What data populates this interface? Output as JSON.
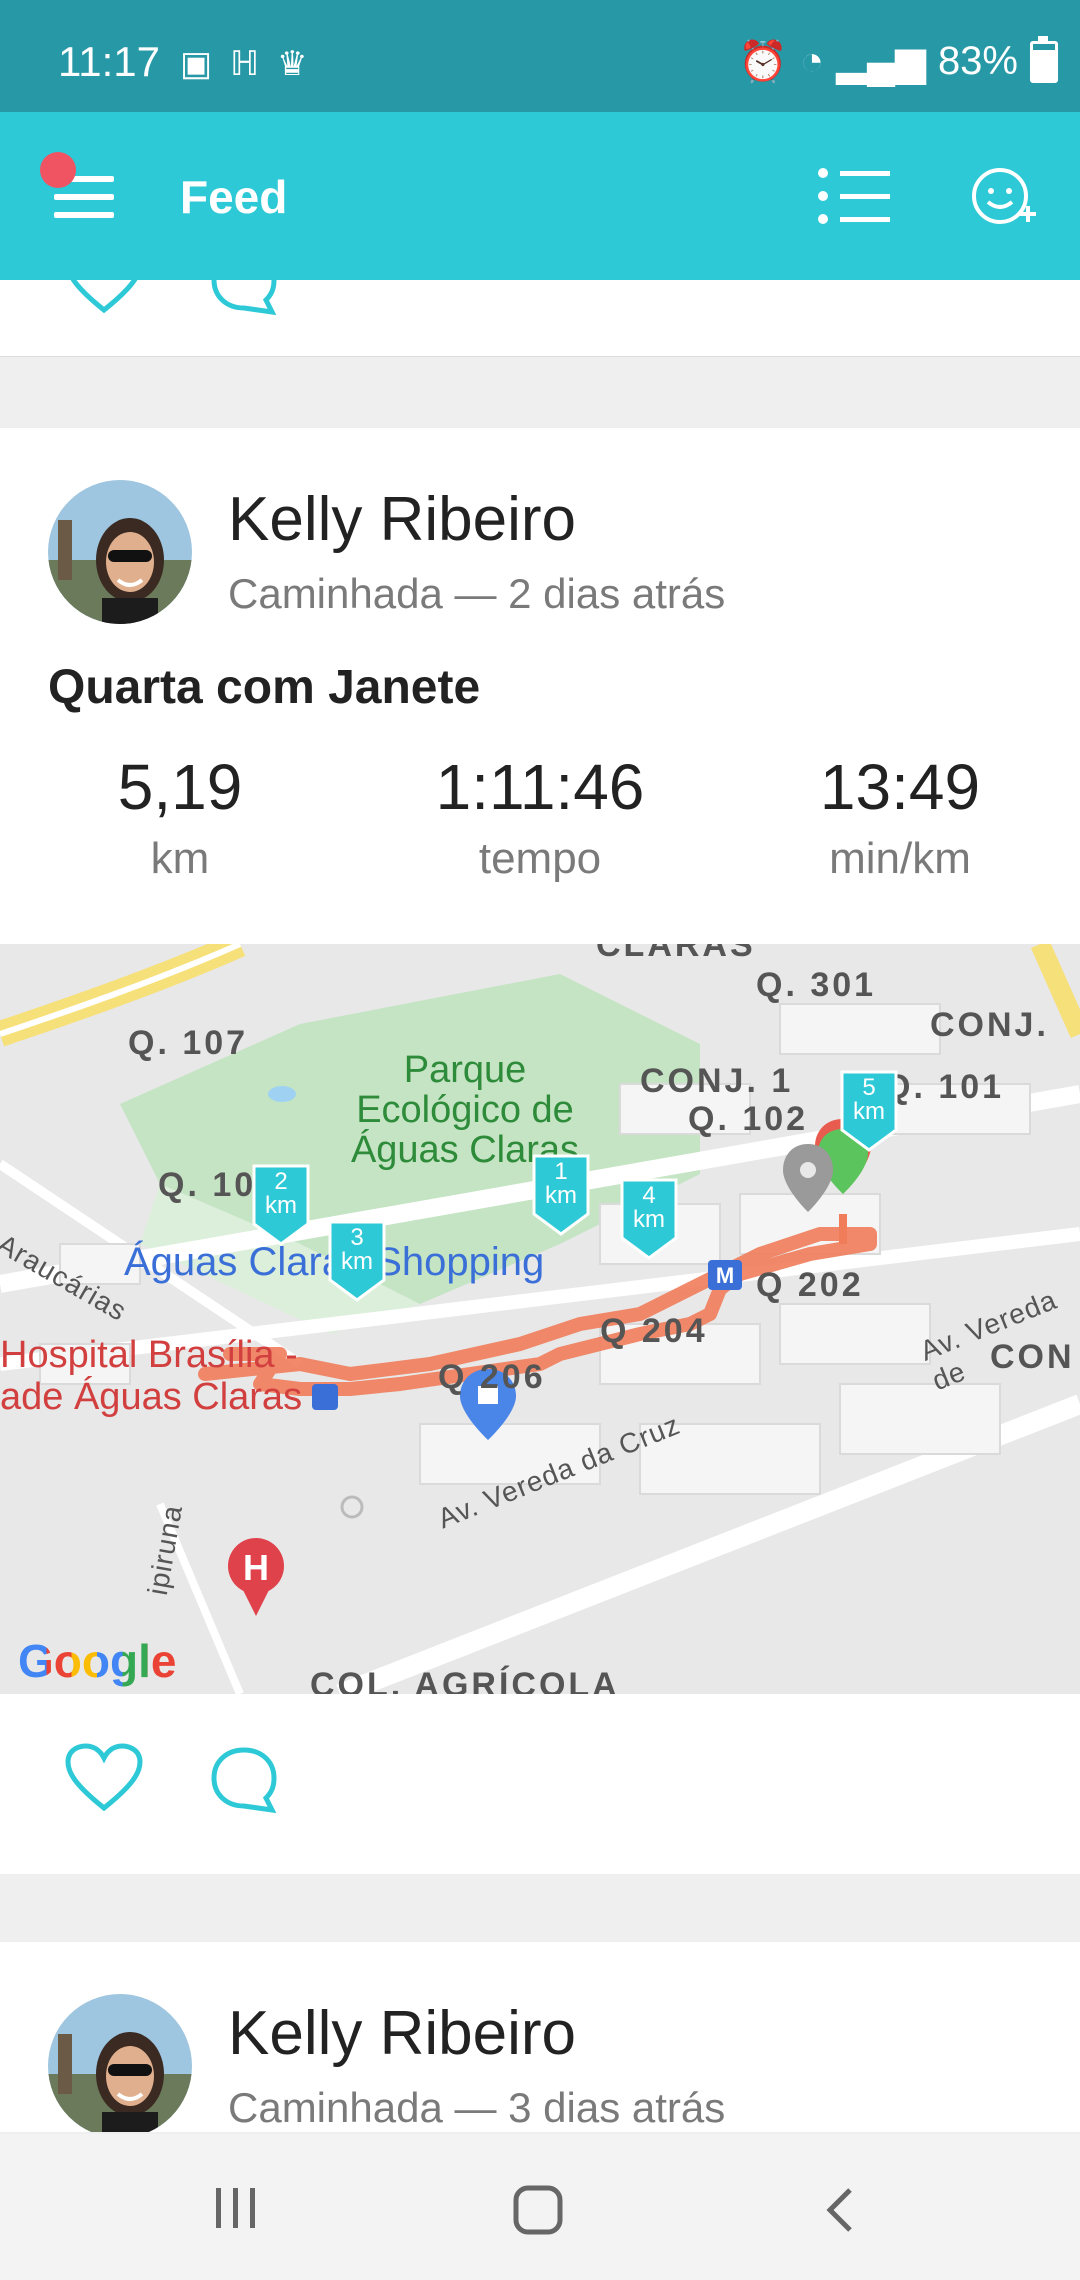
{
  "status_bar": {
    "time": "11:17",
    "battery": "83%",
    "battery_level": 0.83
  },
  "app_bar": {
    "title": "Feed"
  },
  "post": {
    "user_name": "Kelly Ribeiro",
    "subtitle": "Caminhada — 2 dias atrás",
    "title": "Quarta com Janete",
    "stats": [
      {
        "value": "5,19",
        "unit": "km"
      },
      {
        "value": "1:11:46",
        "unit": "tempo"
      },
      {
        "value": "13:49",
        "unit": "min/km"
      }
    ],
    "map": {
      "labels": {
        "claras_top": "CLARAS",
        "q301": "Q. 301",
        "conj_right": "CONJ.",
        "q107": "Q. 107",
        "conj1": "CONJ. 1",
        "q101": "Q. 101",
        "q102": "Q. 102",
        "park": "Parque\nEcológico de\nÁguas Claras",
        "q106": "Q. 106",
        "shopping": "Águas Claras Shopping",
        "araucarias": "Araucárias",
        "q202": "Q 202",
        "av_vereda_right": "Av. Vereda de",
        "con_right": "CON",
        "hospital": "Hospital Brasília -\nade Águas Claras",
        "q204": "Q 204",
        "q206": "Q 206",
        "av_vereda_cruz": "Av. Vereda da Cruz",
        "piruna": "ipiruna",
        "col_agricola": "COL. AGRÍCOLA",
        "google": "Google"
      },
      "km_markers": [
        {
          "n": "1",
          "unit": "km"
        },
        {
          "n": "2",
          "unit": "km"
        },
        {
          "n": "3",
          "unit": "km"
        },
        {
          "n": "4",
          "unit": "km"
        },
        {
          "n": "5",
          "unit": "km"
        }
      ]
    }
  },
  "next_post": {
    "user_name": "Kelly Ribeiro",
    "subtitle": "Caminhada — 3 dias atrás"
  }
}
